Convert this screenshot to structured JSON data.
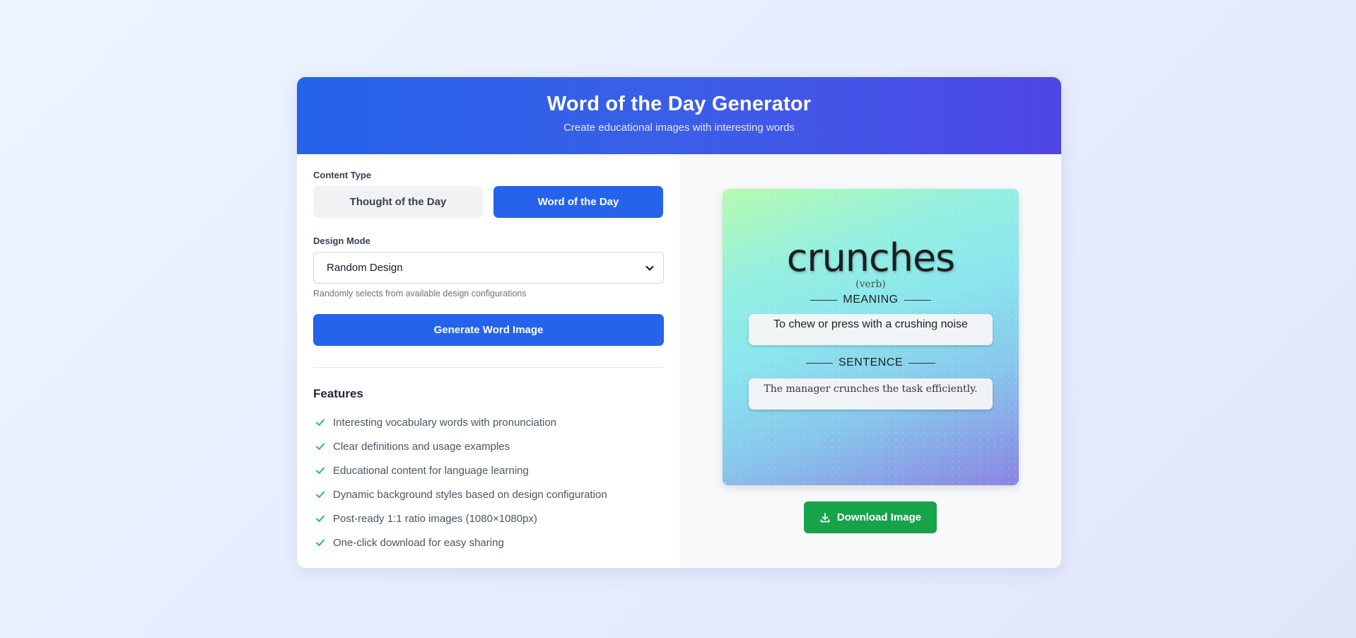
{
  "header": {
    "title": "Word of the Day Generator",
    "subtitle": "Create educational images with interesting words"
  },
  "content_type": {
    "label": "Content Type",
    "options": [
      {
        "label": "Thought of the Day",
        "selected": false
      },
      {
        "label": "Word of the Day",
        "selected": true
      }
    ]
  },
  "design_mode": {
    "label": "Design Mode",
    "selected": "Random Design",
    "hint": "Randomly selects from available design configurations"
  },
  "generate_button": "Generate Word Image",
  "features": {
    "title": "Features",
    "items": [
      "Interesting vocabulary words with pronunciation",
      "Clear definitions and usage examples",
      "Educational content for language learning",
      "Dynamic background styles based on design configuration",
      "Post-ready 1:1 ratio images (1080×1080px)",
      "One-click download for easy sharing"
    ]
  },
  "preview": {
    "word": "crunches",
    "part_of_speech": "(verb)",
    "meaning_label": "MEANING",
    "meaning": "To chew or press with a crushing noise",
    "sentence_label": "SENTENCE",
    "sentence": "The manager crunches the task efficiently."
  },
  "download_button": "Download Image",
  "colors": {
    "primary": "#2563eb",
    "header_end": "#4f46e5",
    "success": "#16a34a",
    "check": "#22c55e"
  },
  "icons": {
    "check": "check-icon",
    "download": "download-icon",
    "select": "chevron-down-icon"
  }
}
